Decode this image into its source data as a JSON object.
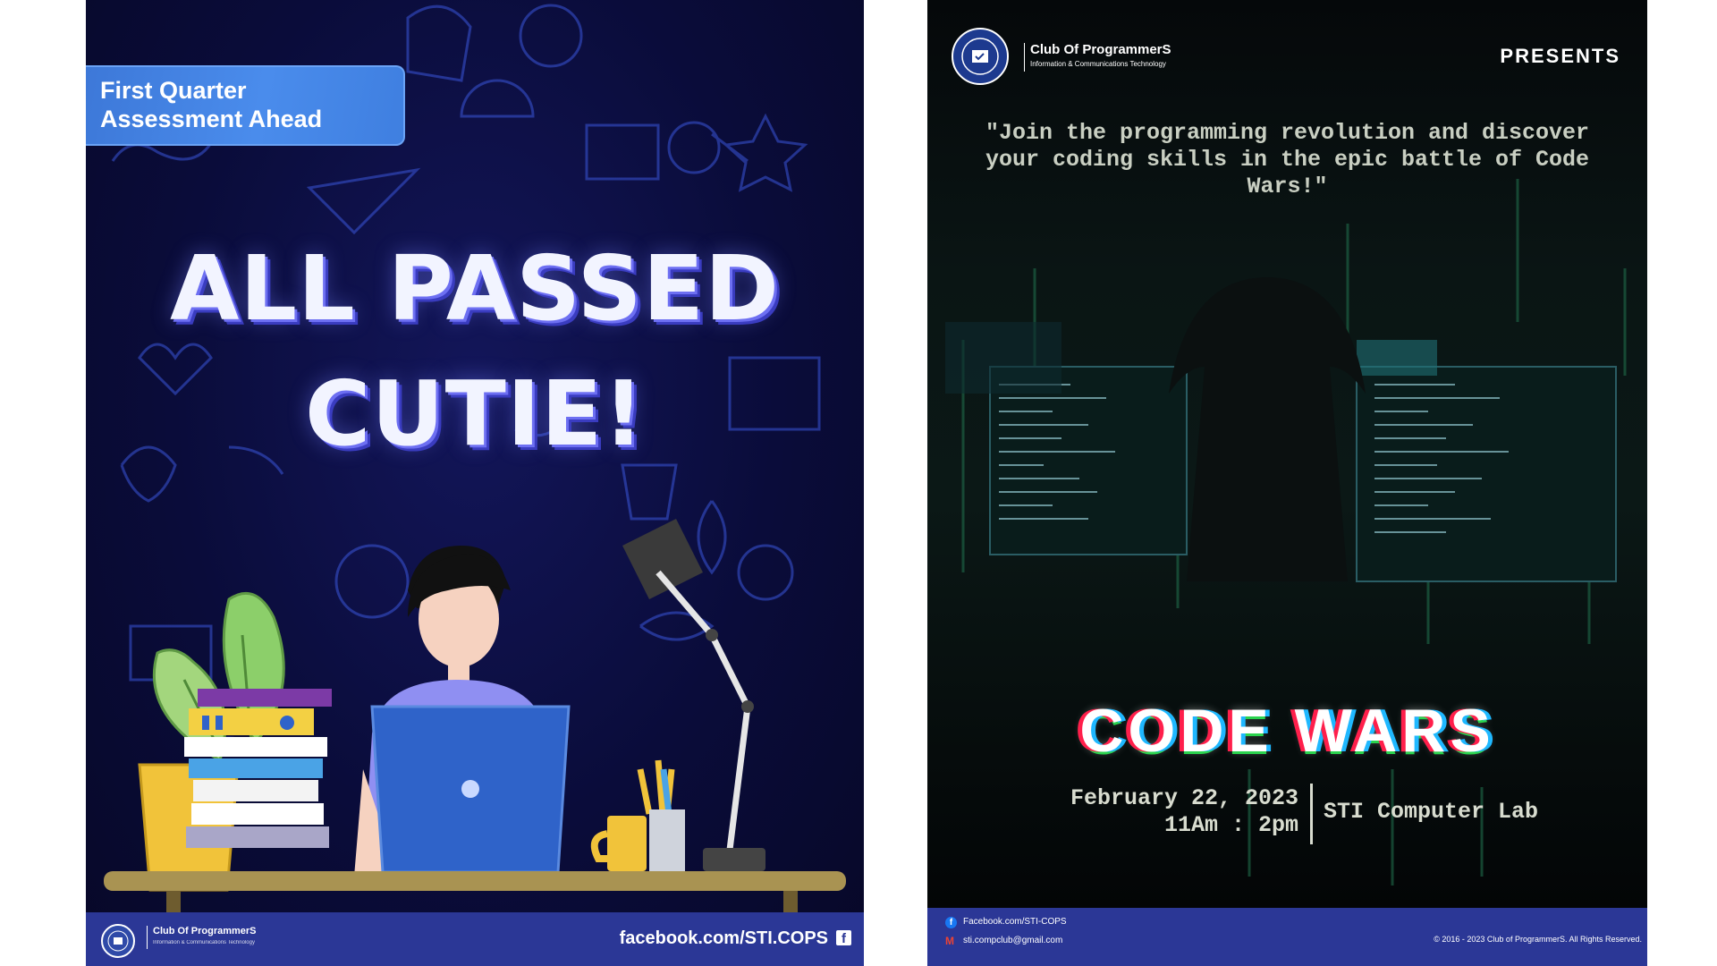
{
  "poster_left": {
    "tag": {
      "line1": "First Quarter",
      "line2": "Assessment Ahead"
    },
    "headline": {
      "line1": "ALL PASSED",
      "line2": "CUTIE!"
    },
    "footer": {
      "club_name": "Club Of ProgrammerS",
      "club_subtitle": "Information & Communications Technology",
      "facebook": "facebook.com/STI.COPS",
      "facebook_icon": "f"
    },
    "colors": {
      "background": "#0a0c3a",
      "footer": "#2b3796",
      "tag": "#4a8cec",
      "headline_shadow": "#6d6ff2"
    }
  },
  "poster_right": {
    "header": {
      "club_name": "Club Of ProgrammerS",
      "club_subtitle": "Information & Communications Technology",
      "presents": "PRESENTS"
    },
    "quote": "\"Join the programming revolution and discover your coding skills in the epic battle of Code Wars!\"",
    "title": "CODE WARS",
    "date_line1": "February 22, 2023",
    "date_line2": "11Am : 2pm",
    "venue": "STI Computer Lab",
    "footer": {
      "facebook": "Facebook.com/STI-COPS",
      "email": "sti.compclub@gmail.com",
      "copyright": "© 2016 - 2023 Club of ProgrammerS. All Rights Reserved.",
      "facebook_icon": "f",
      "email_icon": "M"
    },
    "colors": {
      "background": "#05080a",
      "footer": "#2b3796",
      "glitch_red": "#ff1f4b",
      "glitch_blue": "#1fb8ff"
    }
  }
}
